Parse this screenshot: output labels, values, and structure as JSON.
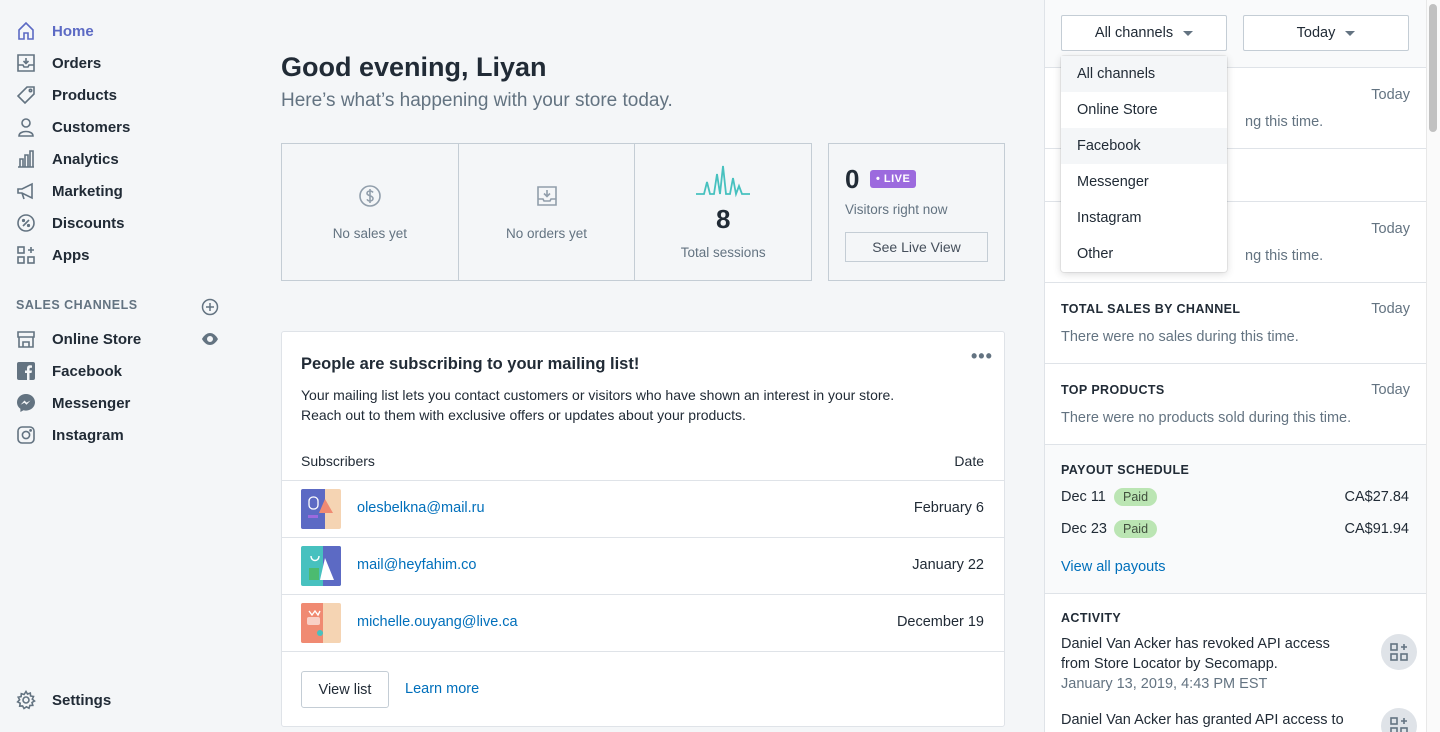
{
  "sidebar": {
    "items": [
      {
        "label": "Home",
        "icon": "home-icon"
      },
      {
        "label": "Orders",
        "icon": "orders-icon"
      },
      {
        "label": "Products",
        "icon": "tag-icon"
      },
      {
        "label": "Customers",
        "icon": "person-icon"
      },
      {
        "label": "Analytics",
        "icon": "bar-chart-icon"
      },
      {
        "label": "Marketing",
        "icon": "megaphone-icon"
      },
      {
        "label": "Discounts",
        "icon": "discount-icon"
      },
      {
        "label": "Apps",
        "icon": "apps-icon"
      }
    ],
    "sales_channels_heading": "SALES CHANNELS",
    "channels": [
      {
        "label": "Online Store",
        "icon": "store-icon"
      },
      {
        "label": "Facebook",
        "icon": "facebook-icon"
      },
      {
        "label": "Messenger",
        "icon": "messenger-icon"
      },
      {
        "label": "Instagram",
        "icon": "instagram-icon"
      }
    ],
    "settings": {
      "label": "Settings",
      "icon": "gear-icon"
    }
  },
  "main": {
    "greeting": "Good evening, Liyan",
    "subgreeting": "Here’s what’s happening with your store today.",
    "stats": {
      "sales": "No sales yet",
      "orders": "No orders yet",
      "sessions_value": "8",
      "sessions_label": "Total sessions"
    },
    "live": {
      "count": "0",
      "badge": "• LIVE",
      "label": "Visitors right now",
      "button": "See Live View"
    },
    "mailing": {
      "title": "People are subscribing to your mailing list!",
      "desc_line1": "Your mailing list lets you contact customers or visitors who have shown an interest in your store.",
      "desc_line2": "Reach out to them with exclusive offers or updates about your products.",
      "col_subscribers": "Subscribers",
      "col_date": "Date",
      "rows": [
        {
          "email": "olesbelkna@mail.ru",
          "date": "February 6"
        },
        {
          "email": "mail@heyfahim.co",
          "date": "January 22"
        },
        {
          "email": "michelle.ouyang@live.ca",
          "date": "December 19"
        }
      ],
      "view_list": "View list",
      "learn_more": "Learn more"
    }
  },
  "right": {
    "channel_select": "All channels",
    "date_select": "Today",
    "sec1_time": "Today",
    "sec1_text": "ng this time.",
    "sec3_time": "Today",
    "sec3_text": "ng this time.",
    "sales_by_channel": {
      "heading": "TOTAL SALES BY CHANNEL",
      "time": "Today",
      "text": "There were no sales during this time."
    },
    "top_products": {
      "heading": "TOP PRODUCTS",
      "time": "Today",
      "text": "There were no products sold during this time."
    },
    "payout": {
      "heading": "PAYOUT SCHEDULE",
      "rows": [
        {
          "date": "Dec 11",
          "status": "Paid",
          "amount": "CA$27.84"
        },
        {
          "date": "Dec 23",
          "status": "Paid",
          "amount": "CA$91.94"
        }
      ],
      "link": "View all payouts"
    },
    "activity": {
      "heading": "ACTIVITY",
      "items": [
        {
          "text": "Daniel Van Acker has revoked API access from Store Locator by Secomapp.",
          "time": "January 13, 2019, 4:43 PM EST"
        },
        {
          "text": "Daniel Van Acker has granted API access to",
          "time": ""
        }
      ]
    }
  },
  "dropdown": {
    "options": [
      "All channels",
      "Online Store",
      "Facebook",
      "Messenger",
      "Instagram",
      "Other"
    ]
  },
  "colors": {
    "accent": "#5c6ac4",
    "link": "#006fbb",
    "live": "#9c6ade",
    "paid": "#bbe5b3",
    "sessions_spark": "#47c1bf"
  }
}
